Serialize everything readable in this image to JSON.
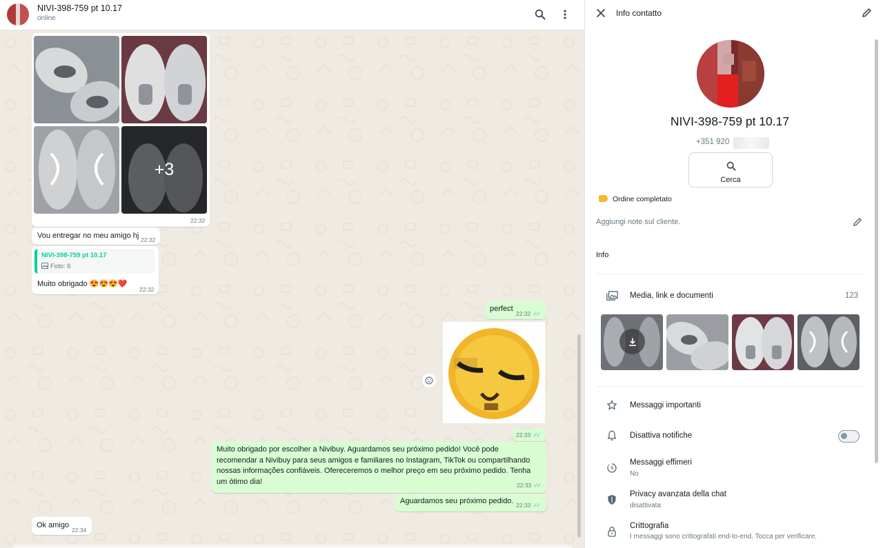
{
  "chat": {
    "contact_name": "NIVI-398-759 pt 10.17",
    "status": "online",
    "messages": {
      "album_time": "22:32",
      "album_more": "+3",
      "m1_text": "Vou entregar no meu amigo hj",
      "m1_time": "22:32",
      "m2_quote_name": "NIVI-398-759 pt 10.17",
      "m2_quote_sub": "Foto: 6",
      "m2_text": "Muito obrigado 😍😍😍❤️",
      "m2_time": "22:32",
      "m3_text": "perfect",
      "m3_time": "22:32",
      "m4_time": "22:33",
      "m5_text": "Muito obrigado por escolher a Nivibuy. Aguardamos seu próximo pedido! Você pode recomendar a Nivibuy para seus amigos e familiares no Instagram, TikTok ou compartilhando nossas informações confiáveis. Ofereceremos o melhor preço em seu próximo pedido. Tenha um ótimo dia!",
      "m5_time": "22:33",
      "m6_text": "Aguardamos seu próximo pedido.",
      "m6_time": "22:33",
      "m7_text": "Ok amigo",
      "m7_time": "22:34"
    }
  },
  "info": {
    "title": "Info contatto",
    "name": "NIVI-398-759 pt 10.17",
    "phone_visible": "+351 920",
    "search_label": "Cerca",
    "label_tag": "Ordine completato",
    "notes_placeholder": "Aggiungi note sul cliente.",
    "section_info": "Info",
    "media_title": "Media, link e documenti",
    "media_count": "123",
    "starred": "Messaggi importanti",
    "mute": "Disattiva notifiche",
    "ephemeral_title": "Messaggi effimeri",
    "ephemeral_sub": "No",
    "privacy_title": "Privacy avanzata della chat",
    "privacy_sub": "disattivata",
    "encryption_title": "Crittografia",
    "encryption_sub": "I messaggi sono crittografati end-to-end. Tocca per verificare."
  },
  "colors": {
    "chat_bg": "#efeae2",
    "outgoing_bubble": "#d9fdd3",
    "incoming_bubble": "#ffffff",
    "quote_accent": "#06cf9c",
    "read_ticks": "#53bdeb",
    "label_tag": "#f5b82e"
  },
  "icons": [
    "search-icon",
    "menu-icon",
    "close-icon",
    "edit-icon",
    "emoji-icon",
    "label-icon",
    "gallery-icon",
    "download-icon",
    "star-icon",
    "bell-icon",
    "timer-icon",
    "shield-icon",
    "lock-icon"
  ]
}
